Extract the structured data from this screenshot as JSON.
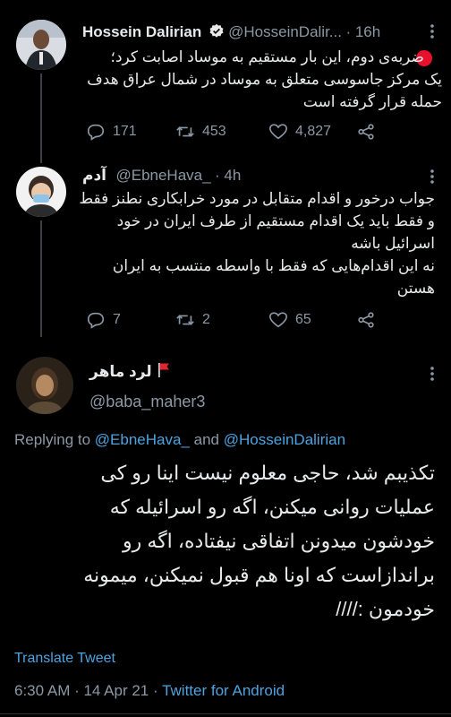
{
  "tweet1": {
    "name": "Hossein Dalirian",
    "handle": "@HosseinDalir...",
    "time": "· 16h",
    "line1": "ضربه‌ی دوم، این بار مستقیم به موساد اصابت کرد؛",
    "line2": "یک مرکز جاسوسی متعلق به موساد در شمال عراق هدف",
    "line3": "حمله قرار گرفته است",
    "replies": "171",
    "retweets": "453",
    "likes": "4,827"
  },
  "tweet2": {
    "name": "آدم",
    "handle": "@EbneHava_",
    "time": "· 4h",
    "line1": "جواب درخور و اقدام متقابل در مورد خرابکاری نطنز فقط",
    "line2": "و فقط باید یک اقدام مستقیم از طرف ایران در خود",
    "line3": "اسرائیل باشه",
    "line4": "نه این اقدام‌هایی که فقط با واسطه منتسب به ایران",
    "line5": "هستن",
    "replies": "7",
    "retweets": "2",
    "likes": "65"
  },
  "main": {
    "name": "لرد ماهر",
    "handle": "@baba_maher3",
    "reply_prefix": "Replying to",
    "reply_user1": "@EbneHava_",
    "reply_and": "and",
    "reply_user2": "@HosseinDalirian",
    "line1": "تکذیبم شد، حاجی معلوم نیست اینا رو کی",
    "line2": "عملیات روانی میکنن، اگه رو اسرائیله که",
    "line3": "خودشون میدونن اتفاقی نیفتاده، اگه رو",
    "line4": "براندازاست که اونا هم قبول نمیکنن، میمونه",
    "line5": "خودمون :////",
    "translate": "Translate Tweet",
    "timestamp": "6:30 AM · 14 Apr 21 ·",
    "source": "Twitter for Android"
  }
}
